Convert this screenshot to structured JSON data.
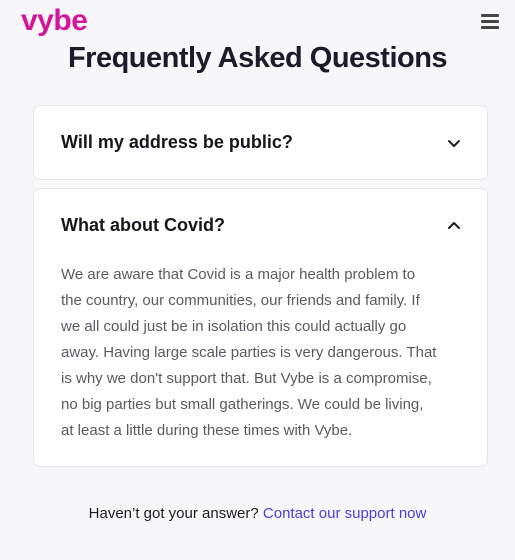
{
  "brand": {
    "logo_text": "vybe",
    "accent_color": "#d4169a"
  },
  "header": {
    "menu_icon": "hamburger-menu-icon"
  },
  "page": {
    "title": "Frequently Asked Questions"
  },
  "faq": [
    {
      "question": "Will my address be public?",
      "expanded": false,
      "icon": "chevron-down-icon"
    },
    {
      "question": "What about Covid?",
      "expanded": true,
      "icon": "chevron-up-icon",
      "answer": "We are aware that Covid is a major health problem to the country, our communities, our friends and family. If we all could just be in isolation this could actually go away. Having large scale parties is very dangerous. That is why we don't support that. But Vybe is a compromise, no big parties but small gatherings. We could be living, at least a little during these times with Vybe."
    }
  ],
  "footer": {
    "prompt": "Haven’t got your answer?",
    "link_text": "Contact our support now",
    "link_color": "#4a3fd6"
  }
}
